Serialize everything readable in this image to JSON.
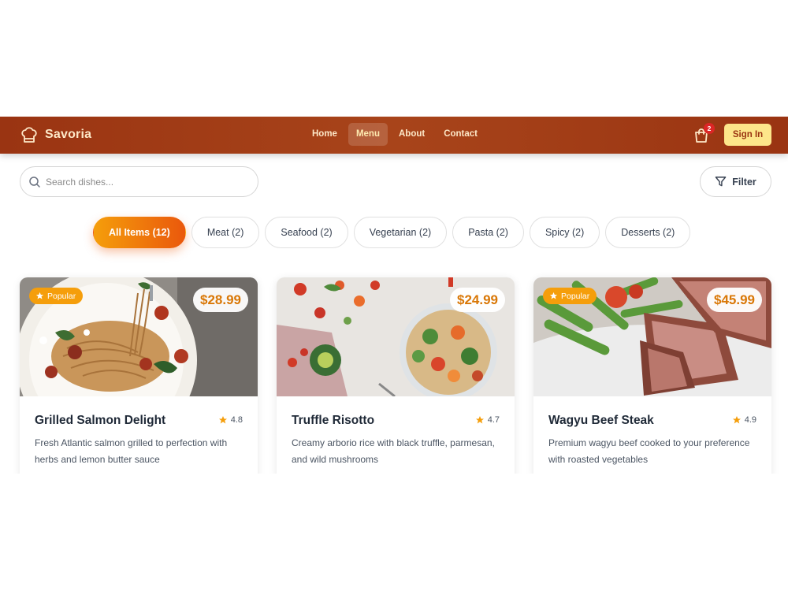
{
  "brand": {
    "name": "Savoria",
    "icon": "chef-hat-icon"
  },
  "nav": {
    "links": [
      {
        "label": "Home",
        "active": false
      },
      {
        "label": "Menu",
        "active": true
      },
      {
        "label": "About",
        "active": false
      },
      {
        "label": "Contact",
        "active": false
      }
    ],
    "cart_count": "2",
    "signin_label": "Sign In"
  },
  "search": {
    "placeholder": "Search dishes...",
    "value": ""
  },
  "filter": {
    "label": "Filter"
  },
  "categories": [
    {
      "label": "All Items (12)",
      "active": true
    },
    {
      "label": "Meat (2)",
      "active": false
    },
    {
      "label": "Seafood (2)",
      "active": false
    },
    {
      "label": "Vegetarian (2)",
      "active": false
    },
    {
      "label": "Pasta (2)",
      "active": false
    },
    {
      "label": "Spicy (2)",
      "active": false
    },
    {
      "label": "Desserts (2)",
      "active": false
    }
  ],
  "dishes": [
    {
      "name": "Grilled Salmon Delight",
      "price": "$28.99",
      "rating": "4.8",
      "popular": true,
      "popular_label": "Popular",
      "description": "Fresh Atlantic salmon grilled to perfection with herbs and lemon butter sauce"
    },
    {
      "name": "Truffle Risotto",
      "price": "$24.99",
      "rating": "4.7",
      "popular": false,
      "popular_label": "",
      "description": "Creamy arborio rice with black truffle, parmesan, and wild mushrooms"
    },
    {
      "name": "Wagyu Beef Steak",
      "price": "$45.99",
      "rating": "4.9",
      "popular": true,
      "popular_label": "Popular",
      "description": "Premium wagyu beef cooked to your preference with roasted vegetables"
    }
  ],
  "colors": {
    "header": "#9a3412",
    "accent": "#f59e0b",
    "accent_dark": "#ea580c",
    "signin_bg": "#fde68a",
    "price": "#d97706",
    "badge": "#dc2626"
  }
}
